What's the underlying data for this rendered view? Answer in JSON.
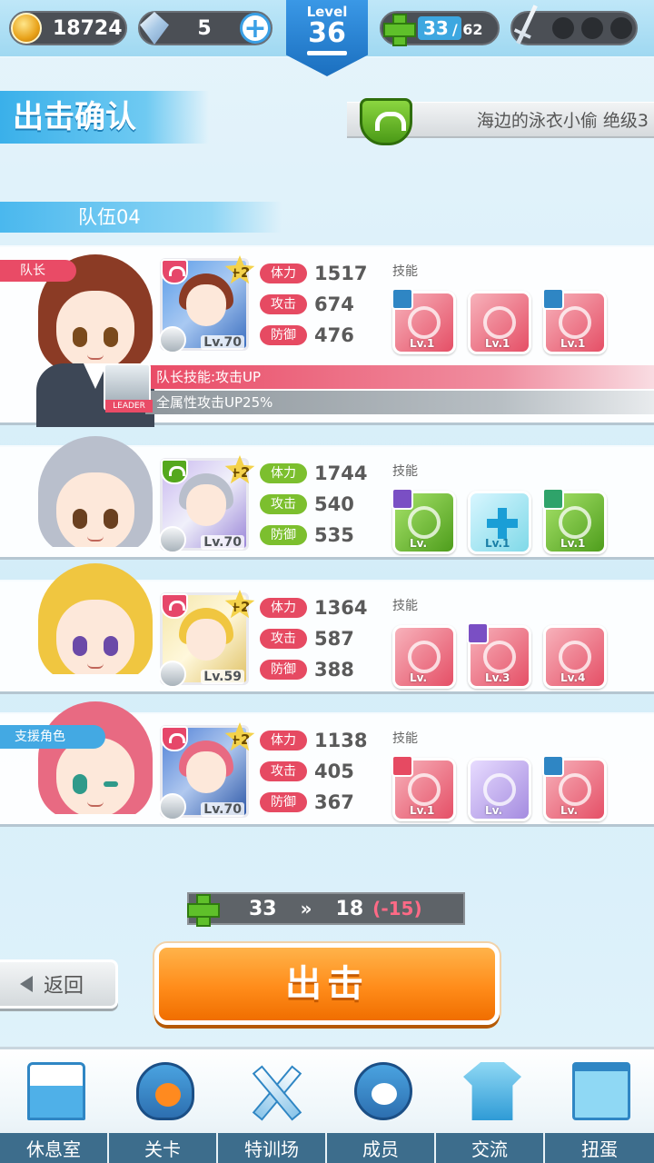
{
  "topbar": {
    "coins": "18724",
    "gems": "5",
    "gem_add": "+",
    "level_label": "Level",
    "level": "36",
    "stamina": "33",
    "stamina_max": "/ 62",
    "stamina_fraction": 0.53
  },
  "header": {
    "title": "出击确认",
    "stage": "海边的泳衣小偷 绝级3",
    "team": "队伍04"
  },
  "members": [
    {
      "role_label": "队长",
      "hp_label": "体力",
      "hp": "1517",
      "atk_label": "攻击",
      "atk": "674",
      "def_label": "防御",
      "def": "476",
      "card_level": "Lv.70",
      "card_bonus": "+2",
      "attr_color": "#e6476a",
      "skills_label": "技能",
      "skills": [
        {
          "level": "Lv.1",
          "color": "red"
        },
        {
          "level": "Lv.1",
          "color": "red"
        },
        {
          "level": "Lv.1",
          "color": "red"
        }
      ],
      "leader_skill": "队长技能:攻击UP",
      "leader_effect": "全属性攻击UP25%",
      "leader_badge": "LEADER"
    },
    {
      "role_label": "",
      "hp_label": "体力",
      "hp": "1744",
      "atk_label": "攻击",
      "atk": "540",
      "def_label": "防御",
      "def": "535",
      "card_level": "Lv.70",
      "card_bonus": "+2",
      "attr_color": "#55a81e",
      "skills_label": "技能",
      "skills": [
        {
          "level": "Lv.",
          "color": "green"
        },
        {
          "level": "Lv.1",
          "color": "teal"
        },
        {
          "level": "Lv.1",
          "color": "green"
        }
      ]
    },
    {
      "role_label": "",
      "hp_label": "体力",
      "hp": "1364",
      "atk_label": "攻击",
      "atk": "587",
      "def_label": "防御",
      "def": "388",
      "card_level": "Lv.59",
      "card_bonus": "+2",
      "attr_color": "#e6476a",
      "skills_label": "技能",
      "skills": [
        {
          "level": "Lv.",
          "color": "red"
        },
        {
          "level": "Lv.3",
          "color": "red"
        },
        {
          "level": "Lv.4",
          "color": "red"
        }
      ]
    },
    {
      "role_label": "支援角色",
      "hp_label": "体力",
      "hp": "1138",
      "atk_label": "攻击",
      "atk": "405",
      "def_label": "防御",
      "def": "367",
      "card_level": "Lv.70",
      "card_bonus": "+2",
      "attr_color": "#e6476a",
      "skills_label": "技能",
      "skills": [
        {
          "level": "Lv.1",
          "color": "red"
        },
        {
          "level": "Lv.",
          "color": "purple"
        },
        {
          "level": "Lv.",
          "color": "red"
        }
      ]
    }
  ],
  "cost": {
    "current": "33",
    "arrow": "»",
    "after": "18",
    "diff": "(-15)"
  },
  "buttons": {
    "back": "返回",
    "sortie": "出击"
  },
  "nav": [
    {
      "label": "休息室",
      "icon": "school-icon"
    },
    {
      "label": "关卡",
      "icon": "stage-monster-icon"
    },
    {
      "label": "特训场",
      "icon": "crossed-swords-icon"
    },
    {
      "label": "成员",
      "icon": "cat-mascot-icon"
    },
    {
      "label": "交流",
      "icon": "uniform-icon"
    },
    {
      "label": "扭蛋",
      "icon": "curtain-icon"
    }
  ],
  "colors": {
    "hp": "#e64a62",
    "atk": "#e64a62",
    "def": "#e64a62",
    "hp_green": "#7cbf2e",
    "accent": "#3ab0ea",
    "sortie": "#ff8c1a"
  }
}
